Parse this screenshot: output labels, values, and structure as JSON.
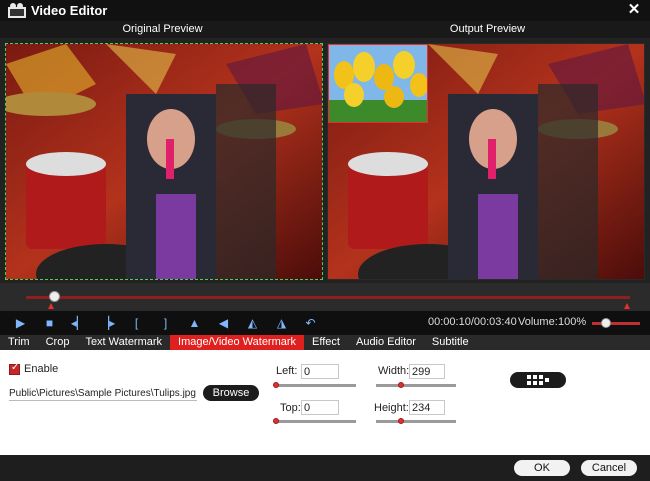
{
  "window": {
    "title": "Video Editor",
    "app_icon": "film-icon",
    "close_icon": "close-icon",
    "close_glyph": "✕"
  },
  "preview": {
    "original_label": "Original Preview",
    "output_label": "Output Preview"
  },
  "timeline": {
    "progress_fraction": 0.047
  },
  "controls": {
    "buttons": [
      {
        "name": "play-button",
        "icon": "play-icon",
        "glyph": "▶"
      },
      {
        "name": "stop-button",
        "icon": "stop-icon",
        "glyph": "■"
      },
      {
        "name": "prev-frame-button",
        "icon": "step-back-icon",
        "glyph": "◂▏"
      },
      {
        "name": "next-frame-button",
        "icon": "step-forward-icon",
        "glyph": "▕▸"
      },
      {
        "name": "mark-in-button",
        "icon": "mark-in-icon",
        "glyph": "["
      },
      {
        "name": "mark-out-button",
        "icon": "mark-out-icon",
        "glyph": "]"
      },
      {
        "name": "flip-vertical-button",
        "icon": "flip-vertical-icon",
        "glyph": "▲"
      },
      {
        "name": "flip-horizontal-button",
        "icon": "flip-horizontal-icon",
        "glyph": "◀"
      },
      {
        "name": "rotate-left-button",
        "icon": "rotate-left-icon",
        "glyph": "◭"
      },
      {
        "name": "rotate-right-button",
        "icon": "rotate-right-icon",
        "glyph": "◮"
      },
      {
        "name": "reset-button",
        "icon": "undo-icon",
        "glyph": "↶"
      }
    ],
    "timecode": "00:00:10/00:03:40",
    "volume_label": "Volume:",
    "volume_value": "100%"
  },
  "tabs": [
    {
      "label": "Trim",
      "active": false
    },
    {
      "label": "Crop",
      "active": false
    },
    {
      "label": "Text Watermark",
      "active": false
    },
    {
      "label": "Image/Video Watermark",
      "active": true
    },
    {
      "label": "Effect",
      "active": false
    },
    {
      "label": "Audio Editor",
      "active": false
    },
    {
      "label": "Subtitle",
      "active": false
    }
  ],
  "watermark": {
    "enable_label": "Enable",
    "enabled": true,
    "file_path": "Public\\Pictures\\Sample Pictures\\Tulips.jpg",
    "browse_label": "Browse",
    "left_label": "Left:",
    "left_value": "0",
    "top_label": "Top:",
    "top_value": "0",
    "width_label": "Width:",
    "width_value": "299",
    "height_label": "Height:",
    "height_value": "234",
    "layout_icon": "grid-position-icon"
  },
  "footer": {
    "ok_label": "OK",
    "cancel_label": "Cancel"
  },
  "colors": {
    "accent": "#e0201e",
    "crop_outline": "#4fd04f",
    "dark_bg": "#1e1e1e"
  }
}
